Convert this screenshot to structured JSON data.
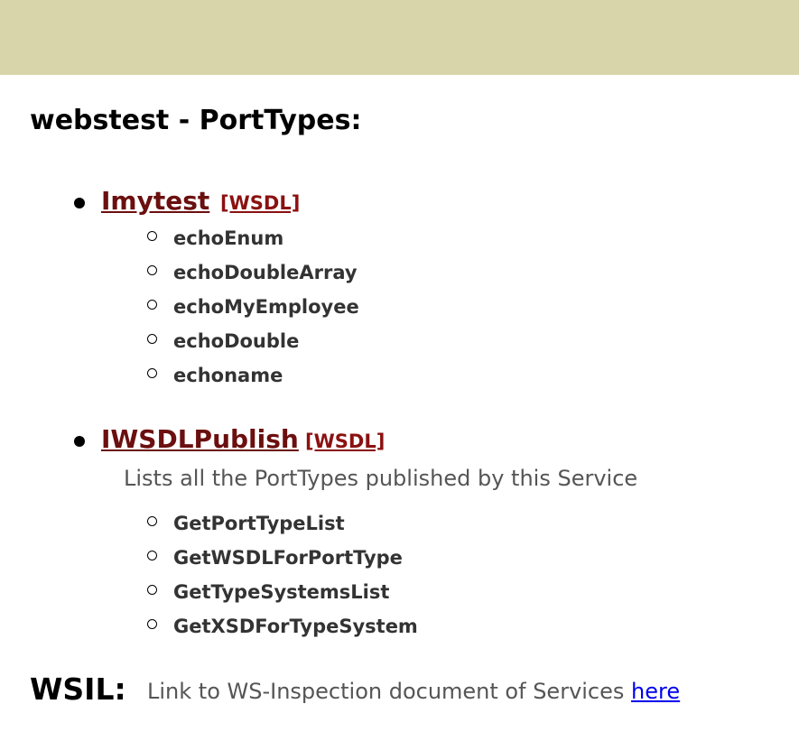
{
  "page_title": "webstest - PortTypes:",
  "porttypes": [
    {
      "name": "Imytest",
      "wsdl_label": "[WSDL]",
      "description": "",
      "operations": [
        "echoEnum",
        "echoDoubleArray",
        "echoMyEmployee",
        "echoDouble",
        "echoname"
      ]
    },
    {
      "name": "IWSDLPublish",
      "wsdl_label": "[WSDL]",
      "description": "Lists all the PortTypes published by this Service",
      "operations": [
        "GetPortTypeList",
        "GetWSDLForPortType",
        "GetTypeSystemsList",
        "GetXSDForTypeSystem"
      ]
    }
  ],
  "wsil": {
    "label": "WSIL:",
    "text": "Link to WS-Inspection document of Services",
    "link_label": "here"
  },
  "colors": {
    "header_band": "#d9d5aa",
    "porttype_link": "#6b0f0f",
    "wsdl_link": "#8b1111",
    "hyperlink": "#0000ee"
  }
}
